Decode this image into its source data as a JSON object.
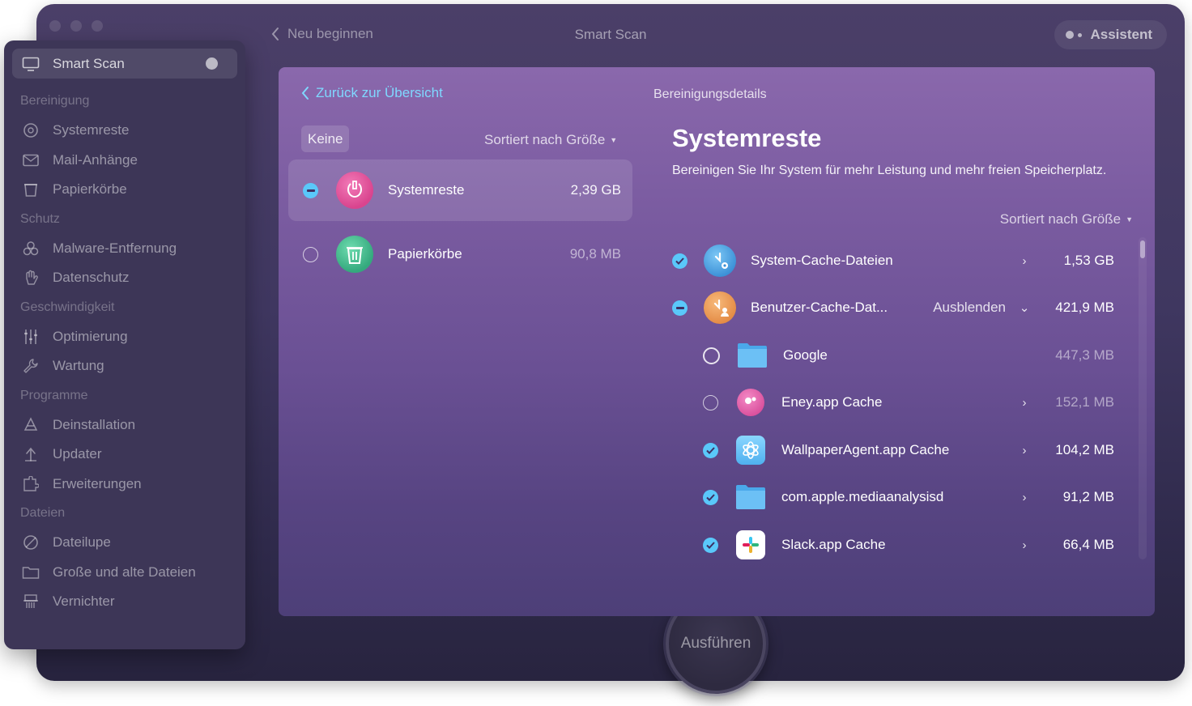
{
  "topbar": {
    "back_label": "Neu beginnen",
    "title": "Smart Scan",
    "assistant_label": "Assistent"
  },
  "sidebar": {
    "active": {
      "label": "Smart Scan",
      "icon": "monitor-icon"
    },
    "sections": [
      {
        "header": "Bereinigung",
        "items": [
          {
            "label": "Systemreste",
            "icon": "disc-icon"
          },
          {
            "label": "Mail-Anhänge",
            "icon": "envelope-icon"
          },
          {
            "label": "Papierkörbe",
            "icon": "trash-icon"
          }
        ]
      },
      {
        "header": "Schutz",
        "items": [
          {
            "label": "Malware-Entfernung",
            "icon": "biohazard-icon"
          },
          {
            "label": "Datenschutz",
            "icon": "hand-icon"
          }
        ]
      },
      {
        "header": "Geschwindigkeit",
        "items": [
          {
            "label": "Optimierung",
            "icon": "sliders-icon"
          },
          {
            "label": "Wartung",
            "icon": "wrench-icon"
          }
        ]
      },
      {
        "header": "Programme",
        "items": [
          {
            "label": "Deinstallation",
            "icon": "apps-icon"
          },
          {
            "label": "Updater",
            "icon": "update-arrow-icon"
          },
          {
            "label": "Erweiterungen",
            "icon": "extension-icon"
          }
        ]
      },
      {
        "header": "Dateien",
        "items": [
          {
            "label": "Dateilupe",
            "icon": "lens-icon"
          },
          {
            "label": "Große und alte Dateien",
            "icon": "folder-icon"
          },
          {
            "label": "Vernichter",
            "icon": "shredder-icon"
          }
        ]
      }
    ]
  },
  "panel": {
    "back_link": "Zurück zur Übersicht",
    "details_title": "Bereinigungsdetails",
    "select_none": "Keine",
    "sort_label": "Sortiert nach Größe",
    "categories": [
      {
        "name": "Systemreste",
        "size": "2,39 GB",
        "state": "partial",
        "color": "#e0559a"
      },
      {
        "name": "Papierkörbe",
        "size": "90,8 MB",
        "state": "off",
        "color": "#3fb98a"
      }
    ],
    "detail": {
      "title": "Systemreste",
      "subtitle": "Bereinigen Sie Ihr System für mehr Leistung und mehr freien Speicherplatz.",
      "sort_label": "Sortiert nach Größe",
      "items": [
        {
          "name": "System-Cache-Dateien",
          "size": "1,53 GB",
          "state": "on",
          "icon": "system-cache-icon"
        },
        {
          "name": "Benutzer-Cache-Dat...",
          "size": "421,9 MB",
          "state": "partial",
          "icon": "user-cache-icon",
          "action": "Ausblenden"
        }
      ],
      "children": [
        {
          "name": "Google",
          "size": "447,3 MB",
          "state": "off",
          "icon": "folder-icon"
        },
        {
          "name": "Eney.app Cache",
          "size": "152,1 MB",
          "state": "off",
          "icon": "eney-app-icon"
        },
        {
          "name": "WallpaperAgent.app Cache",
          "size": "104,2 MB",
          "state": "on",
          "icon": "wallpaper-agent-icon"
        },
        {
          "name": "com.apple.mediaanalysisd",
          "size": "91,2 MB",
          "state": "on",
          "icon": "folder-icon"
        },
        {
          "name": "Slack.app Cache",
          "size": "66,4 MB",
          "state": "on",
          "icon": "slack-icon"
        }
      ]
    }
  },
  "run_button": "Ausführen"
}
